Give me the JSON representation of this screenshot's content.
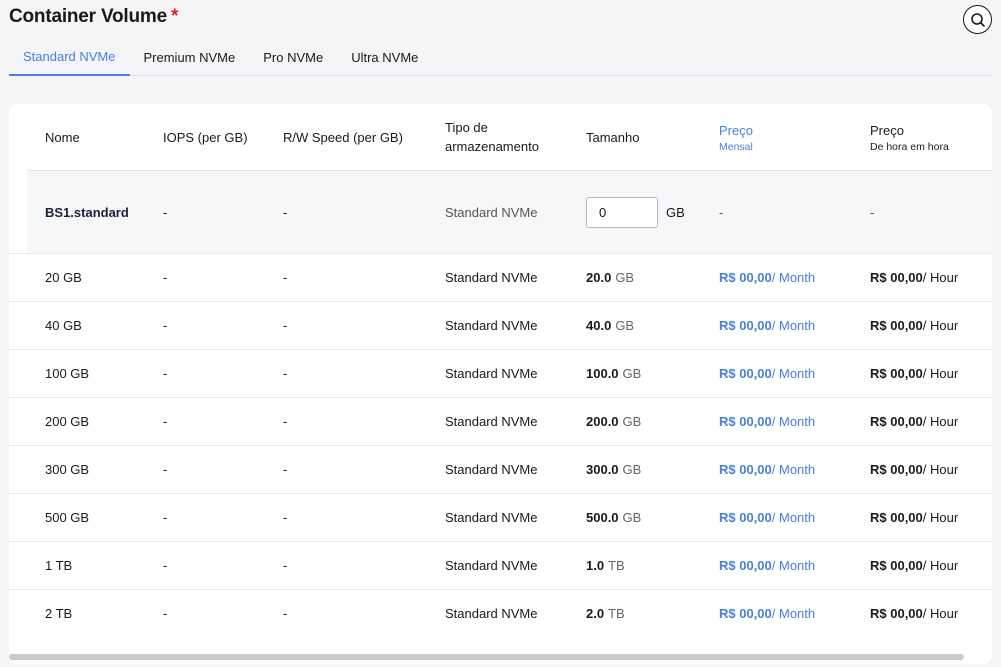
{
  "header": {
    "title": "Container Volume",
    "required_mark": "*"
  },
  "search": {
    "icon": "search-icon"
  },
  "tabs": [
    {
      "label": "Standard NVMe",
      "active": true
    },
    {
      "label": "Premium NVMe",
      "active": false
    },
    {
      "label": "Pro NVMe",
      "active": false
    },
    {
      "label": "Ultra NVMe",
      "active": false
    }
  ],
  "table": {
    "columns": {
      "name": "Nome",
      "iops": "IOPS (per GB)",
      "rw": "R/W Speed (per GB)",
      "type": "Tipo de armazenamento",
      "size": "Tamanho",
      "monthly": {
        "title": "Preço",
        "sub": "Mensal"
      },
      "hourly": {
        "title": "Preço",
        "sub": "De hora em hora"
      }
    },
    "custom_row": {
      "name": "BS1.standard",
      "iops": "-",
      "rw": "-",
      "type": "Standard NVMe",
      "size_value": "0",
      "size_unit": "GB",
      "monthly": "-",
      "hourly": "-"
    },
    "rows": [
      {
        "name": "20 GB",
        "iops": "-",
        "rw": "-",
        "type": "Standard NVMe",
        "size": "20.0",
        "size_unit": "GB",
        "monthly_price": "R$ 00,00",
        "monthly_suffix": "/ Month",
        "hourly_price": "R$ 00,00",
        "hourly_suffix": "/ Hour"
      },
      {
        "name": "40 GB",
        "iops": "-",
        "rw": "-",
        "type": "Standard NVMe",
        "size": "40.0",
        "size_unit": "GB",
        "monthly_price": "R$ 00,00",
        "monthly_suffix": "/ Month",
        "hourly_price": "R$ 00,00",
        "hourly_suffix": "/ Hour"
      },
      {
        "name": "100 GB",
        "iops": "-",
        "rw": "-",
        "type": "Standard NVMe",
        "size": "100.0",
        "size_unit": "GB",
        "monthly_price": "R$ 00,00",
        "monthly_suffix": "/ Month",
        "hourly_price": "R$ 00,00",
        "hourly_suffix": "/ Hour"
      },
      {
        "name": "200 GB",
        "iops": "-",
        "rw": "-",
        "type": "Standard NVMe",
        "size": "200.0",
        "size_unit": "GB",
        "monthly_price": "R$ 00,00",
        "monthly_suffix": "/ Month",
        "hourly_price": "R$ 00,00",
        "hourly_suffix": "/ Hour"
      },
      {
        "name": "300 GB",
        "iops": "-",
        "rw": "-",
        "type": "Standard NVMe",
        "size": "300.0",
        "size_unit": "GB",
        "monthly_price": "R$ 00,00",
        "monthly_suffix": "/ Month",
        "hourly_price": "R$ 00,00",
        "hourly_suffix": "/ Hour"
      },
      {
        "name": "500 GB",
        "iops": "-",
        "rw": "-",
        "type": "Standard NVMe",
        "size": "500.0",
        "size_unit": "GB",
        "monthly_price": "R$ 00,00",
        "monthly_suffix": "/ Month",
        "hourly_price": "R$ 00,00",
        "hourly_suffix": "/ Hour"
      },
      {
        "name": "1 TB",
        "iops": "-",
        "rw": "-",
        "type": "Standard NVMe",
        "size": "1.0",
        "size_unit": "TB",
        "monthly_price": "R$ 00,00",
        "monthly_suffix": "/ Month",
        "hourly_price": "R$ 00,00",
        "hourly_suffix": "/ Hour"
      },
      {
        "name": "2 TB",
        "iops": "-",
        "rw": "-",
        "type": "Standard NVMe",
        "size": "2.0",
        "size_unit": "TB",
        "monthly_price": "R$ 00,00",
        "monthly_suffix": "/ Month",
        "hourly_price": "R$ 00,00",
        "hourly_suffix": "/ Hour"
      }
    ]
  },
  "colors": {
    "accent": "#4a7fe0",
    "required": "#e02424",
    "page_bg": "#f5f5f7",
    "custom_row_bg": "#f6f7f9"
  }
}
